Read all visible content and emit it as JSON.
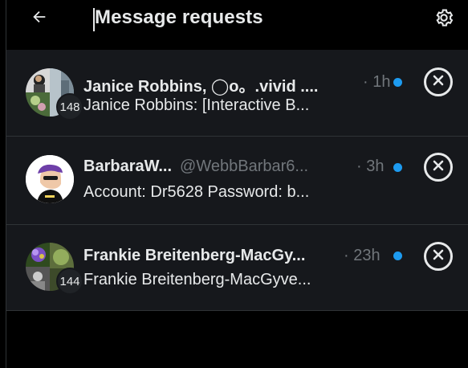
{
  "header": {
    "title": "Message requests",
    "back_icon": "arrow-left-icon",
    "settings_icon": "gear-icon"
  },
  "colors": {
    "background": "#000000",
    "row_background": "#16181c",
    "text_primary": "#e7e9ea",
    "text_secondary": "#71767b",
    "unread_dot": "#1d9bf0"
  },
  "requests": [
    {
      "name": "Janice Robbins, ◯o。.vivid ....",
      "handle": "",
      "time": "· 1h",
      "preview": "Janice Robbins: [Interactive B...",
      "group_count": "148",
      "unread": true
    },
    {
      "name": "BarbaraW...",
      "handle": "@WebbBarbar6...",
      "time": "· 3h",
      "preview": "Account: Dr5628 Password: b...",
      "group_count": "",
      "unread": true
    },
    {
      "name": "Frankie Breitenberg-MacGy...",
      "handle": "",
      "time": "· 23h",
      "preview": "Frankie Breitenberg-MacGyve...",
      "group_count": "144",
      "unread": true
    }
  ]
}
